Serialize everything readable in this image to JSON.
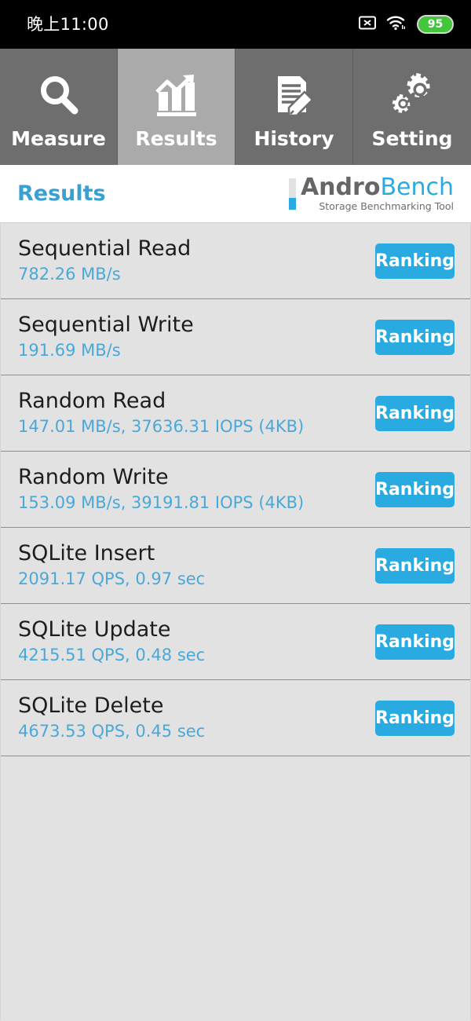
{
  "status_bar": {
    "clock": "晚上11:00",
    "battery_level": "95",
    "icons": [
      "sim-no-card-icon",
      "wifi-icon",
      "battery-icon"
    ]
  },
  "tabs": [
    {
      "label": "Measure",
      "icon": "magnifier-icon",
      "active": false
    },
    {
      "label": "Results",
      "icon": "bar-chart-arrow-icon",
      "active": true
    },
    {
      "label": "History",
      "icon": "document-pencil-icon",
      "active": false
    },
    {
      "label": "Setting",
      "icon": "gears-icon",
      "active": false
    }
  ],
  "header": {
    "title": "Results",
    "logo_primary": "Andro",
    "logo_secondary": "Bench",
    "logo_tagline": "Storage Benchmarking Tool"
  },
  "results": [
    {
      "name": "Sequential Read",
      "value": "782.26 MB/s",
      "button": "Ranking"
    },
    {
      "name": "Sequential Write",
      "value": "191.69 MB/s",
      "button": "Ranking"
    },
    {
      "name": "Random Read",
      "value": "147.01 MB/s, 37636.31 IOPS (4KB)",
      "button": "Ranking"
    },
    {
      "name": "Random Write",
      "value": "153.09 MB/s, 39191.81 IOPS (4KB)",
      "button": "Ranking"
    },
    {
      "name": "SQLite Insert",
      "value": "2091.17 QPS, 0.97 sec",
      "button": "Ranking"
    },
    {
      "name": "SQLite Update",
      "value": "4215.51 QPS, 0.48 sec",
      "button": "Ranking"
    },
    {
      "name": "SQLite Delete",
      "value": "4673.53 QPS, 0.45 sec",
      "button": "Ranking"
    }
  ],
  "colors": {
    "accent_blue": "#29abe2",
    "value_blue": "#4aa8d8",
    "tab_inactive": "#6e6e6e",
    "tab_active": "#aaaaaa",
    "list_bg": "#e3e2e2",
    "battery_green": "#43c63a"
  }
}
